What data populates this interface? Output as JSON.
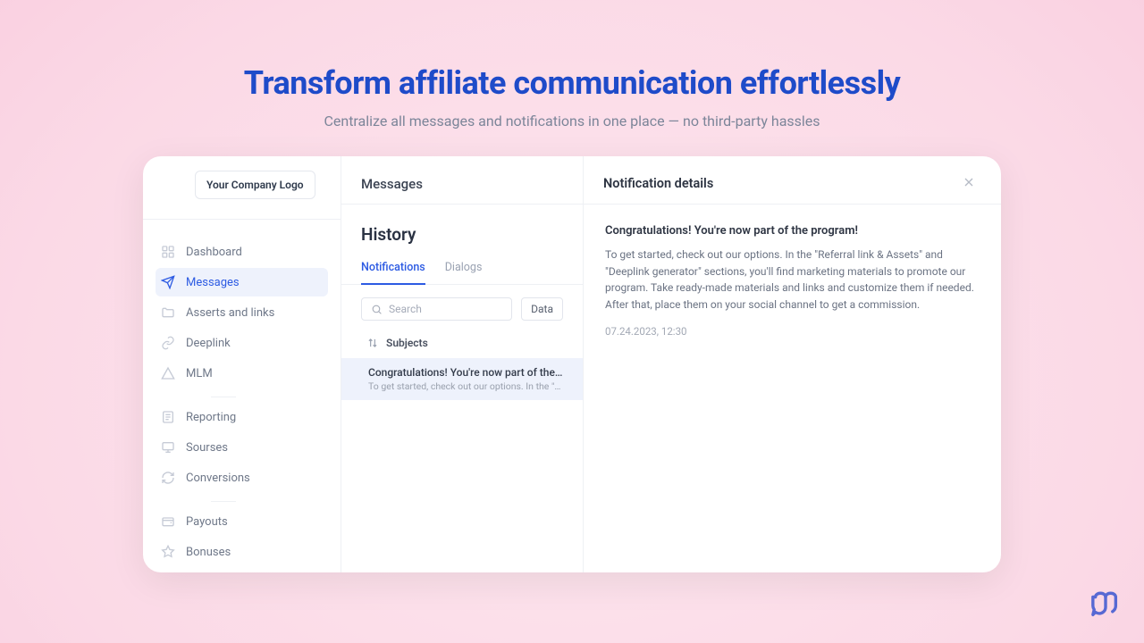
{
  "hero": {
    "title": "Transform affiliate communication effortlessly",
    "subtitle": "Centralize all messages and notifications in one place — no third-party hassles"
  },
  "logo_text": "Your Company Logo",
  "sidebar": {
    "items": [
      {
        "label": "Dashboard"
      },
      {
        "label": "Messages"
      },
      {
        "label": "Asserts and links"
      },
      {
        "label": "Deeplink"
      },
      {
        "label": "MLM"
      },
      {
        "label": "Reporting"
      },
      {
        "label": "Sourses"
      },
      {
        "label": "Conversions"
      },
      {
        "label": "Payouts"
      },
      {
        "label": "Bonuses"
      }
    ]
  },
  "midcol": {
    "heading": "Messages",
    "history": "History",
    "tabs": {
      "notifications": "Notifications",
      "dialogs": "Dialogs"
    },
    "search_placeholder": "Search",
    "data_label": "Data",
    "subjects_label": "Subjects",
    "row": {
      "title": "Congratulations! You're now part of the program!",
      "preview": "To get started, check out our options. In the \"Referral link & Assets\" a"
    }
  },
  "detail": {
    "panel_title": "Notification details",
    "subject": "Congratulations! You're now part of the program!",
    "body": "To get started, check out our options. In the \"Referral link & Assets\" and \"Deeplink generator\" sections, you'll find marketing materials to promote our program. Take ready-made materials and links and customize them if needed. After that, place them on your social channel to get a commission.",
    "timestamp": "07.24.2023, 12:30"
  }
}
